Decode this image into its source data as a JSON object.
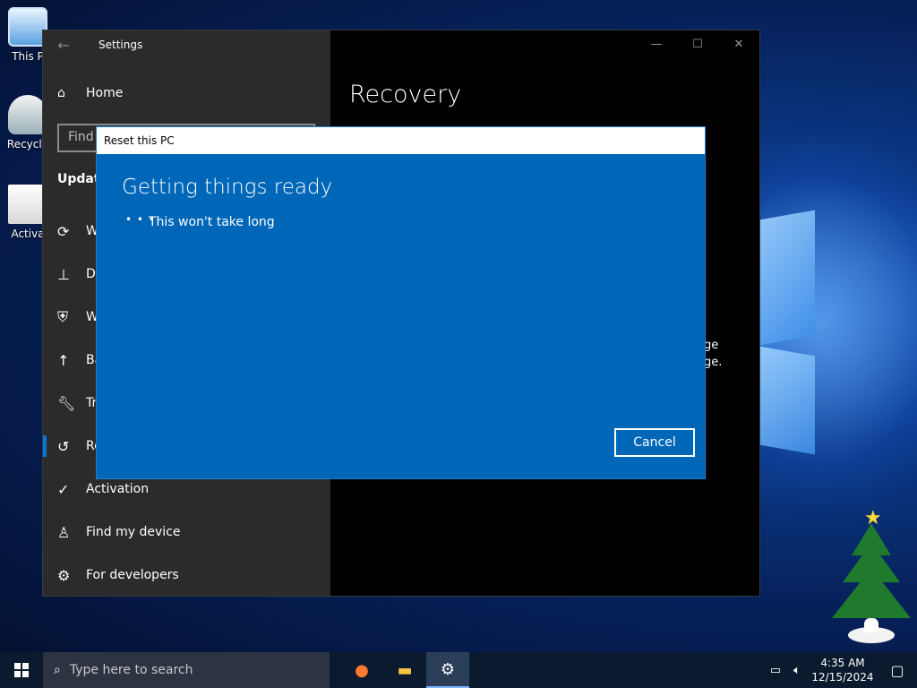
{
  "desktop": {
    "icons": [
      {
        "label": "This P"
      },
      {
        "label": "Recycle"
      },
      {
        "label": "Activa"
      }
    ]
  },
  "settings": {
    "title": "Settings",
    "home_label": "Home",
    "search_placeholder": "Find",
    "section_heading": "Update",
    "nav_items": [
      {
        "label": "W"
      },
      {
        "label": "De"
      },
      {
        "label": "W"
      },
      {
        "label": "Ba"
      },
      {
        "label": "Tr"
      },
      {
        "label": "Re"
      },
      {
        "label": "Activation"
      },
      {
        "label": "Find my device"
      },
      {
        "label": "For developers"
      }
    ],
    "main_title": "Recovery",
    "background_text_1": "age",
    "background_text_2": "age."
  },
  "dialog": {
    "title": "Reset this PC",
    "heading": "Getting things ready",
    "subtext": "This won't take long",
    "cancel_label": "Cancel"
  },
  "taskbar": {
    "search_placeholder": "Type here to search",
    "time": "4:35 AM",
    "date": "12/15/2024"
  },
  "colors": {
    "dialog_bg": "#0067b8",
    "accent": "#0078d4",
    "sidebar_bg": "#2b2b2b"
  }
}
